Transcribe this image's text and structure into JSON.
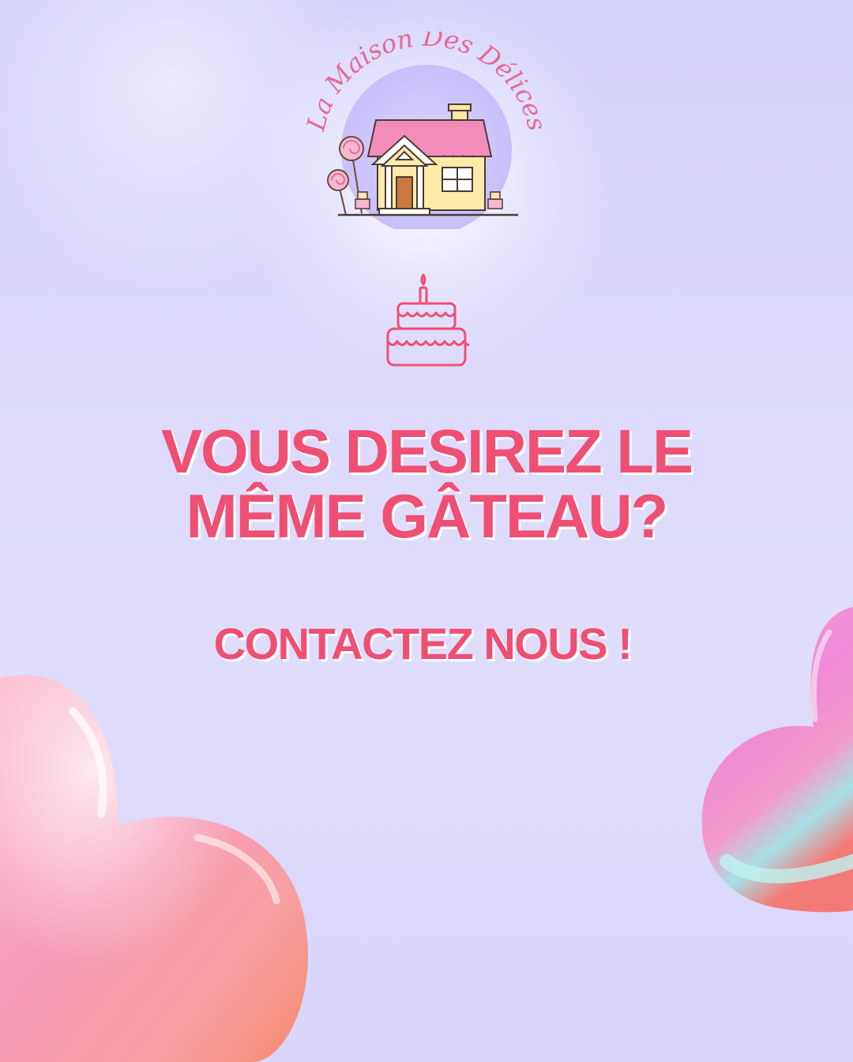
{
  "logo": {
    "arc_text": "La Maison Des Délices",
    "icon": "candy-house-icon"
  },
  "cake_icon": "birthday-cake-icon",
  "headline": {
    "line1": "VOUS DESIREZ LE",
    "line2": "MÊME GÂTEAU?"
  },
  "cta": {
    "label": "CONTACTEZ NOUS !"
  },
  "colors": {
    "accent": "#ef4f73",
    "logo_pink": "#e56b98",
    "background": "#dcd9fb"
  },
  "decor": {
    "left": "heart-balloon-icon",
    "right": "heart-balloon-icon"
  }
}
